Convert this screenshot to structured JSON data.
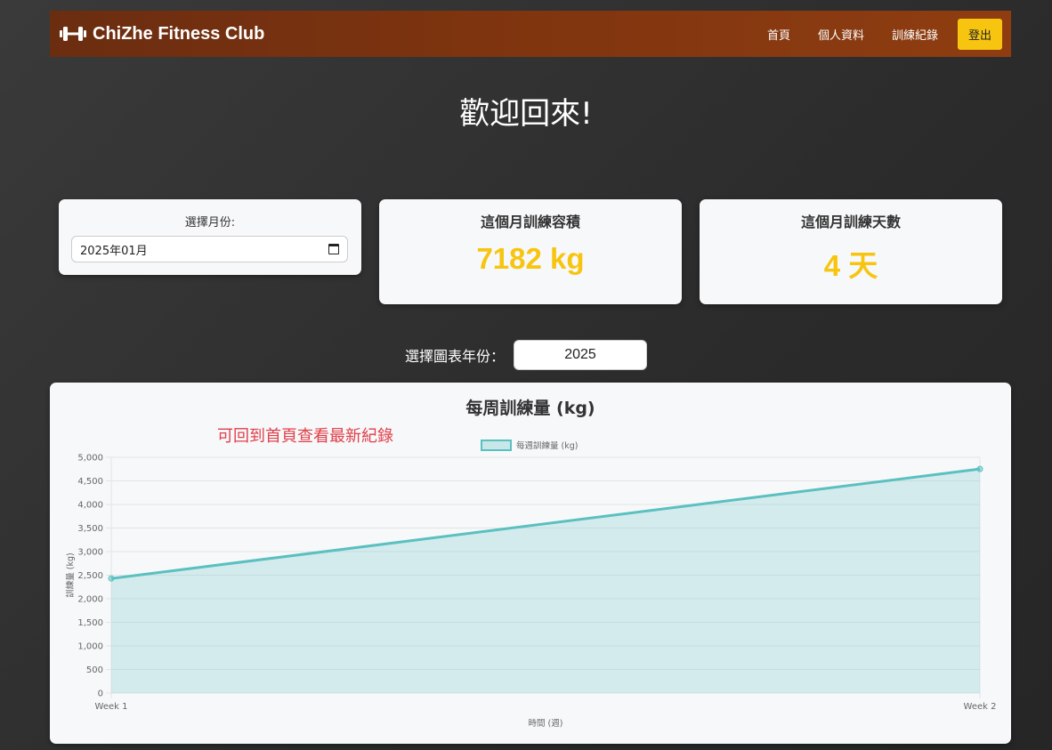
{
  "navbar": {
    "brand": "ChiZhe Fitness Club",
    "links": [
      "首頁",
      "個人資料",
      "訓練紀錄"
    ],
    "logout": "登出",
    "accent_color": "#f7c510",
    "icon": "dumbbell-icon"
  },
  "welcome": "歡迎回來!",
  "month_card": {
    "label": "選擇月份:",
    "value": "2025年01月",
    "icon": "calendar-icon"
  },
  "volume_card": {
    "title": "這個月訓練容積",
    "value": "7182 kg"
  },
  "days_card": {
    "title": "這個月訓練天數",
    "value": "4 天"
  },
  "year_select": {
    "label": "選擇圖表年份：",
    "value": "2025"
  },
  "chart_card": {
    "title": "每周訓練量 (kg)",
    "annotation": "可回到首頁查看最新紀錄"
  },
  "chart_data": {
    "type": "area",
    "x": [
      "Week 1",
      "Week 2"
    ],
    "series": [
      {
        "name": "每週訓練量 (kg)",
        "values": [
          2430,
          4752
        ],
        "color": "#5bc0c0"
      }
    ],
    "xlabel": "時間 (週)",
    "ylabel": "訓練量 (kg)",
    "ylim": [
      0,
      5000
    ],
    "yticks": [
      "0",
      "500",
      "1,000",
      "1,500",
      "2,000",
      "2,500",
      "3,000",
      "3,500",
      "4,000",
      "4,500",
      "5,000"
    ],
    "grid": true,
    "legend": "top-center"
  }
}
